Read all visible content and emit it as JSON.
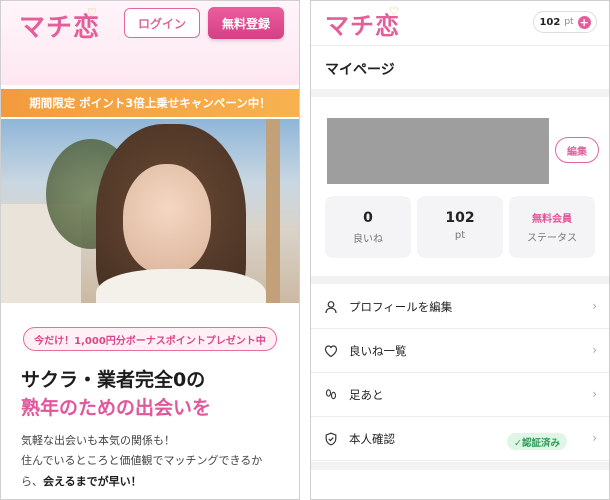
{
  "left": {
    "logo": "マチ恋",
    "login_label": "ログイン",
    "register_label": "無料登録",
    "promo_banner": "期間限定 ポイント3倍上乗せキャンペーン中！",
    "bonus_badge": "今だけ！1,000円分ボーナスポイントプレゼント中",
    "headline_1": "サクラ・業者完全0の",
    "headline_2": "熟年のための出会いを",
    "body_1": "気軽な出会いも本気の関係も！",
    "body_2": "住んでいるところと価値観でマッチングできるか",
    "body_3_prefix": "ら、",
    "body_3_bold": "会えるまでが早い！"
  },
  "right": {
    "logo": "マチ恋",
    "points_value": "102",
    "points_unit": "pt",
    "points_add_icon": "plus-icon",
    "page_title": "マイページ",
    "edit_label": "編集",
    "stats": [
      {
        "value": "0",
        "label": "良いね"
      },
      {
        "value": "102",
        "label": "pt"
      },
      {
        "value": "無料会員",
        "label": "ステータス"
      }
    ],
    "menu": [
      {
        "label": "プロフィールを編集",
        "icon": "person-icon"
      },
      {
        "label": "良いね一覧",
        "icon": "heart-icon"
      },
      {
        "label": "足あと",
        "icon": "footprint-icon"
      },
      {
        "label": "本人確認",
        "icon": "shield-check-icon",
        "badge": "✓認証済み"
      }
    ]
  },
  "colors": {
    "brand_pink": "#e45e9a",
    "promo_orange": "#f39b3c",
    "verified_green": "#2b9d56"
  }
}
